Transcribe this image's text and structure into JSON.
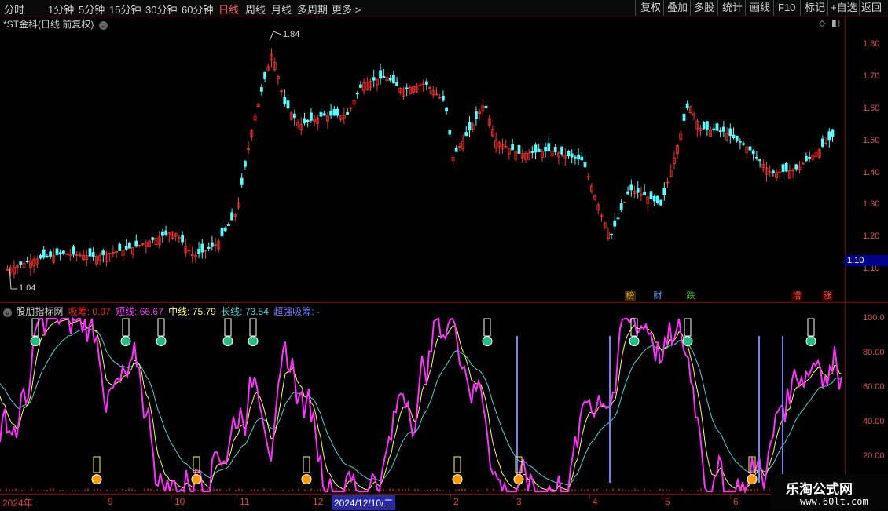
{
  "toolbar": {
    "periods": [
      "分时",
      "1分钟",
      "5分钟",
      "15分钟",
      "30分钟",
      "60分钟",
      "日线",
      "周线",
      "月线",
      "多周期",
      "更多"
    ],
    "active_period": "日线",
    "right_buttons": [
      "复权",
      "叠加",
      "多股",
      "统计",
      "画线",
      "F10",
      "标记",
      "+自选",
      "返回"
    ]
  },
  "price_panel": {
    "title": "*ST金科(日线 前复权)",
    "high_marker": "1.84",
    "low_marker": "1.04",
    "current_price": "1.10",
    "axis_ticks": [
      "1.80",
      "1.70",
      "1.60",
      "1.50",
      "1.40",
      "1.30",
      "1.20",
      "1.10"
    ],
    "badges": [
      {
        "text": "榜",
        "color": "#e0a000"
      },
      {
        "text": "财",
        "color": "#50a0ff"
      },
      {
        "text": "跌",
        "color": "#30d030"
      },
      {
        "text": "增",
        "color": "#ff5050"
      },
      {
        "text": "涨",
        "color": "#ff5050"
      }
    ],
    "up_color": "#ff3030",
    "down_color": "#54ffff"
  },
  "indicator_panel": {
    "name": "股朋指标网",
    "values": [
      {
        "label": "吸筹: 0.07",
        "color": "#ff2020"
      },
      {
        "label": "短线: 66.67",
        "color": "#ff30ff"
      },
      {
        "label": "中线: 75.79",
        "color": "#ffff40"
      },
      {
        "label": "长线: 73.54",
        "color": "#40d8d8"
      },
      {
        "label": "超强吸筹: -",
        "color": "#6a80ff"
      }
    ],
    "axis_ticks": [
      "100.0",
      "80.00",
      "60.00",
      "40.00",
      "20.00"
    ]
  },
  "date_axis": {
    "labels": [
      "2024年",
      "9",
      "10",
      "11",
      "12",
      "2",
      "3",
      "4",
      "5",
      "6"
    ],
    "cursor_date": "2024/12/10/二"
  },
  "watermark": {
    "line1": "乐淘公式网",
    "line2": "www.60lt.com"
  }
}
